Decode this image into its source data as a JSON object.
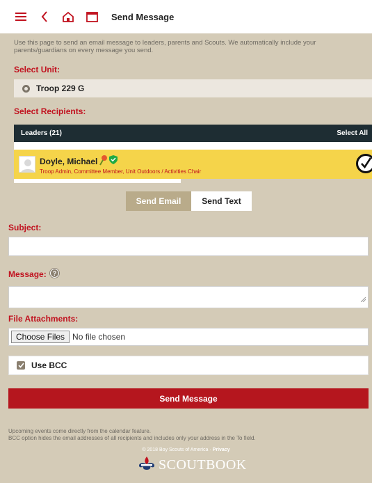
{
  "header": {
    "title": "Send Message",
    "icons": [
      "menu-icon",
      "back-chevron-icon",
      "home-icon",
      "calendar-icon"
    ]
  },
  "intro_text": "Use this page to send an email message to leaders, parents and Scouts. We automatically include your parents/guardians on every message you send.",
  "select_unit": {
    "label": "Select Unit:",
    "selected": "Troop 229 G"
  },
  "select_recipients": {
    "label": "Select Recipients:",
    "group_title": "Leaders (21)",
    "select_all_label": "Select All",
    "leader": {
      "name": "Doyle, Michael",
      "roles": "Troop Admin, Committee Member, Unit Outdoors / Activities Chair",
      "selected": true
    }
  },
  "tabs": [
    {
      "label": "Send Email",
      "active": true
    },
    {
      "label": "Send Text",
      "active": false
    }
  ],
  "form": {
    "subject_label": "Subject:",
    "subject_value": "",
    "message_label": "Message:",
    "message_value": "",
    "attachments_label": "File Attachments:",
    "choose_files_label": "Choose Files",
    "no_file_text": "No file chosen",
    "bcc_label": "Use BCC",
    "bcc_checked": true,
    "send_label": "Send Message"
  },
  "notes": [
    "Upcoming events come directly from the calendar feature.",
    "BCC option hides the email addresses of all recipients and includes only your address in the To field."
  ],
  "footer": {
    "copyright": "© 2018 Boy Scouts of America ·",
    "privacy_link": "Privacy",
    "brand": "SCOUTBOOK"
  },
  "colors": {
    "accent_red": "#c1121f",
    "page_bg": "#d4cbb7",
    "leader_highlight": "#f5d44a",
    "header_dark": "#1e2d33"
  }
}
